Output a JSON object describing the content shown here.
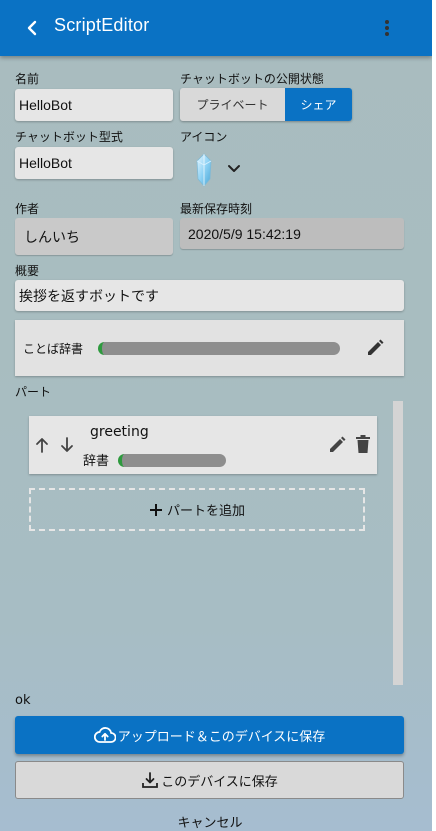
{
  "appbar": {
    "title": "ScriptEditor",
    "back_icon": "chevron-left-icon",
    "menu_icon": "more-vert-icon"
  },
  "form": {
    "name_label": "名前",
    "name_value": "HelloBot",
    "visibility_label": "チャットボットの公開状態",
    "visibility_options": [
      "プライベート",
      "シェア"
    ],
    "visibility_selected": "シェア",
    "model_label": "チャットボット型式",
    "model_value": "HelloBot",
    "icon_label": "アイコン",
    "icon_name": "crystal-icon",
    "author_label": "作者",
    "author_value": "しんいち",
    "saved_label": "最新保存時刻",
    "saved_value": "2020/5/9 15:42:19",
    "summary_label": "概要",
    "summary_value": "挨拶を返すボットです"
  },
  "dictionary": {
    "label": "ことば辞書",
    "edit_icon": "pencil-icon"
  },
  "parts": {
    "label": "パート",
    "items": [
      {
        "name": "greeting",
        "dict_label": "辞書",
        "up_icon": "arrow-up-icon",
        "down_icon": "arrow-down-icon",
        "edit_icon": "pencil-icon",
        "delete_icon": "trash-icon"
      }
    ],
    "add_label": "パートを追加"
  },
  "status": "ok",
  "actions": {
    "upload_save": "アップロード＆このデバイスに保存",
    "save_device": "このデバイスに保存",
    "cancel": "キャンセル"
  },
  "colors": {
    "primary": "#0a72c4",
    "progress_accent": "#2e9a3e"
  }
}
